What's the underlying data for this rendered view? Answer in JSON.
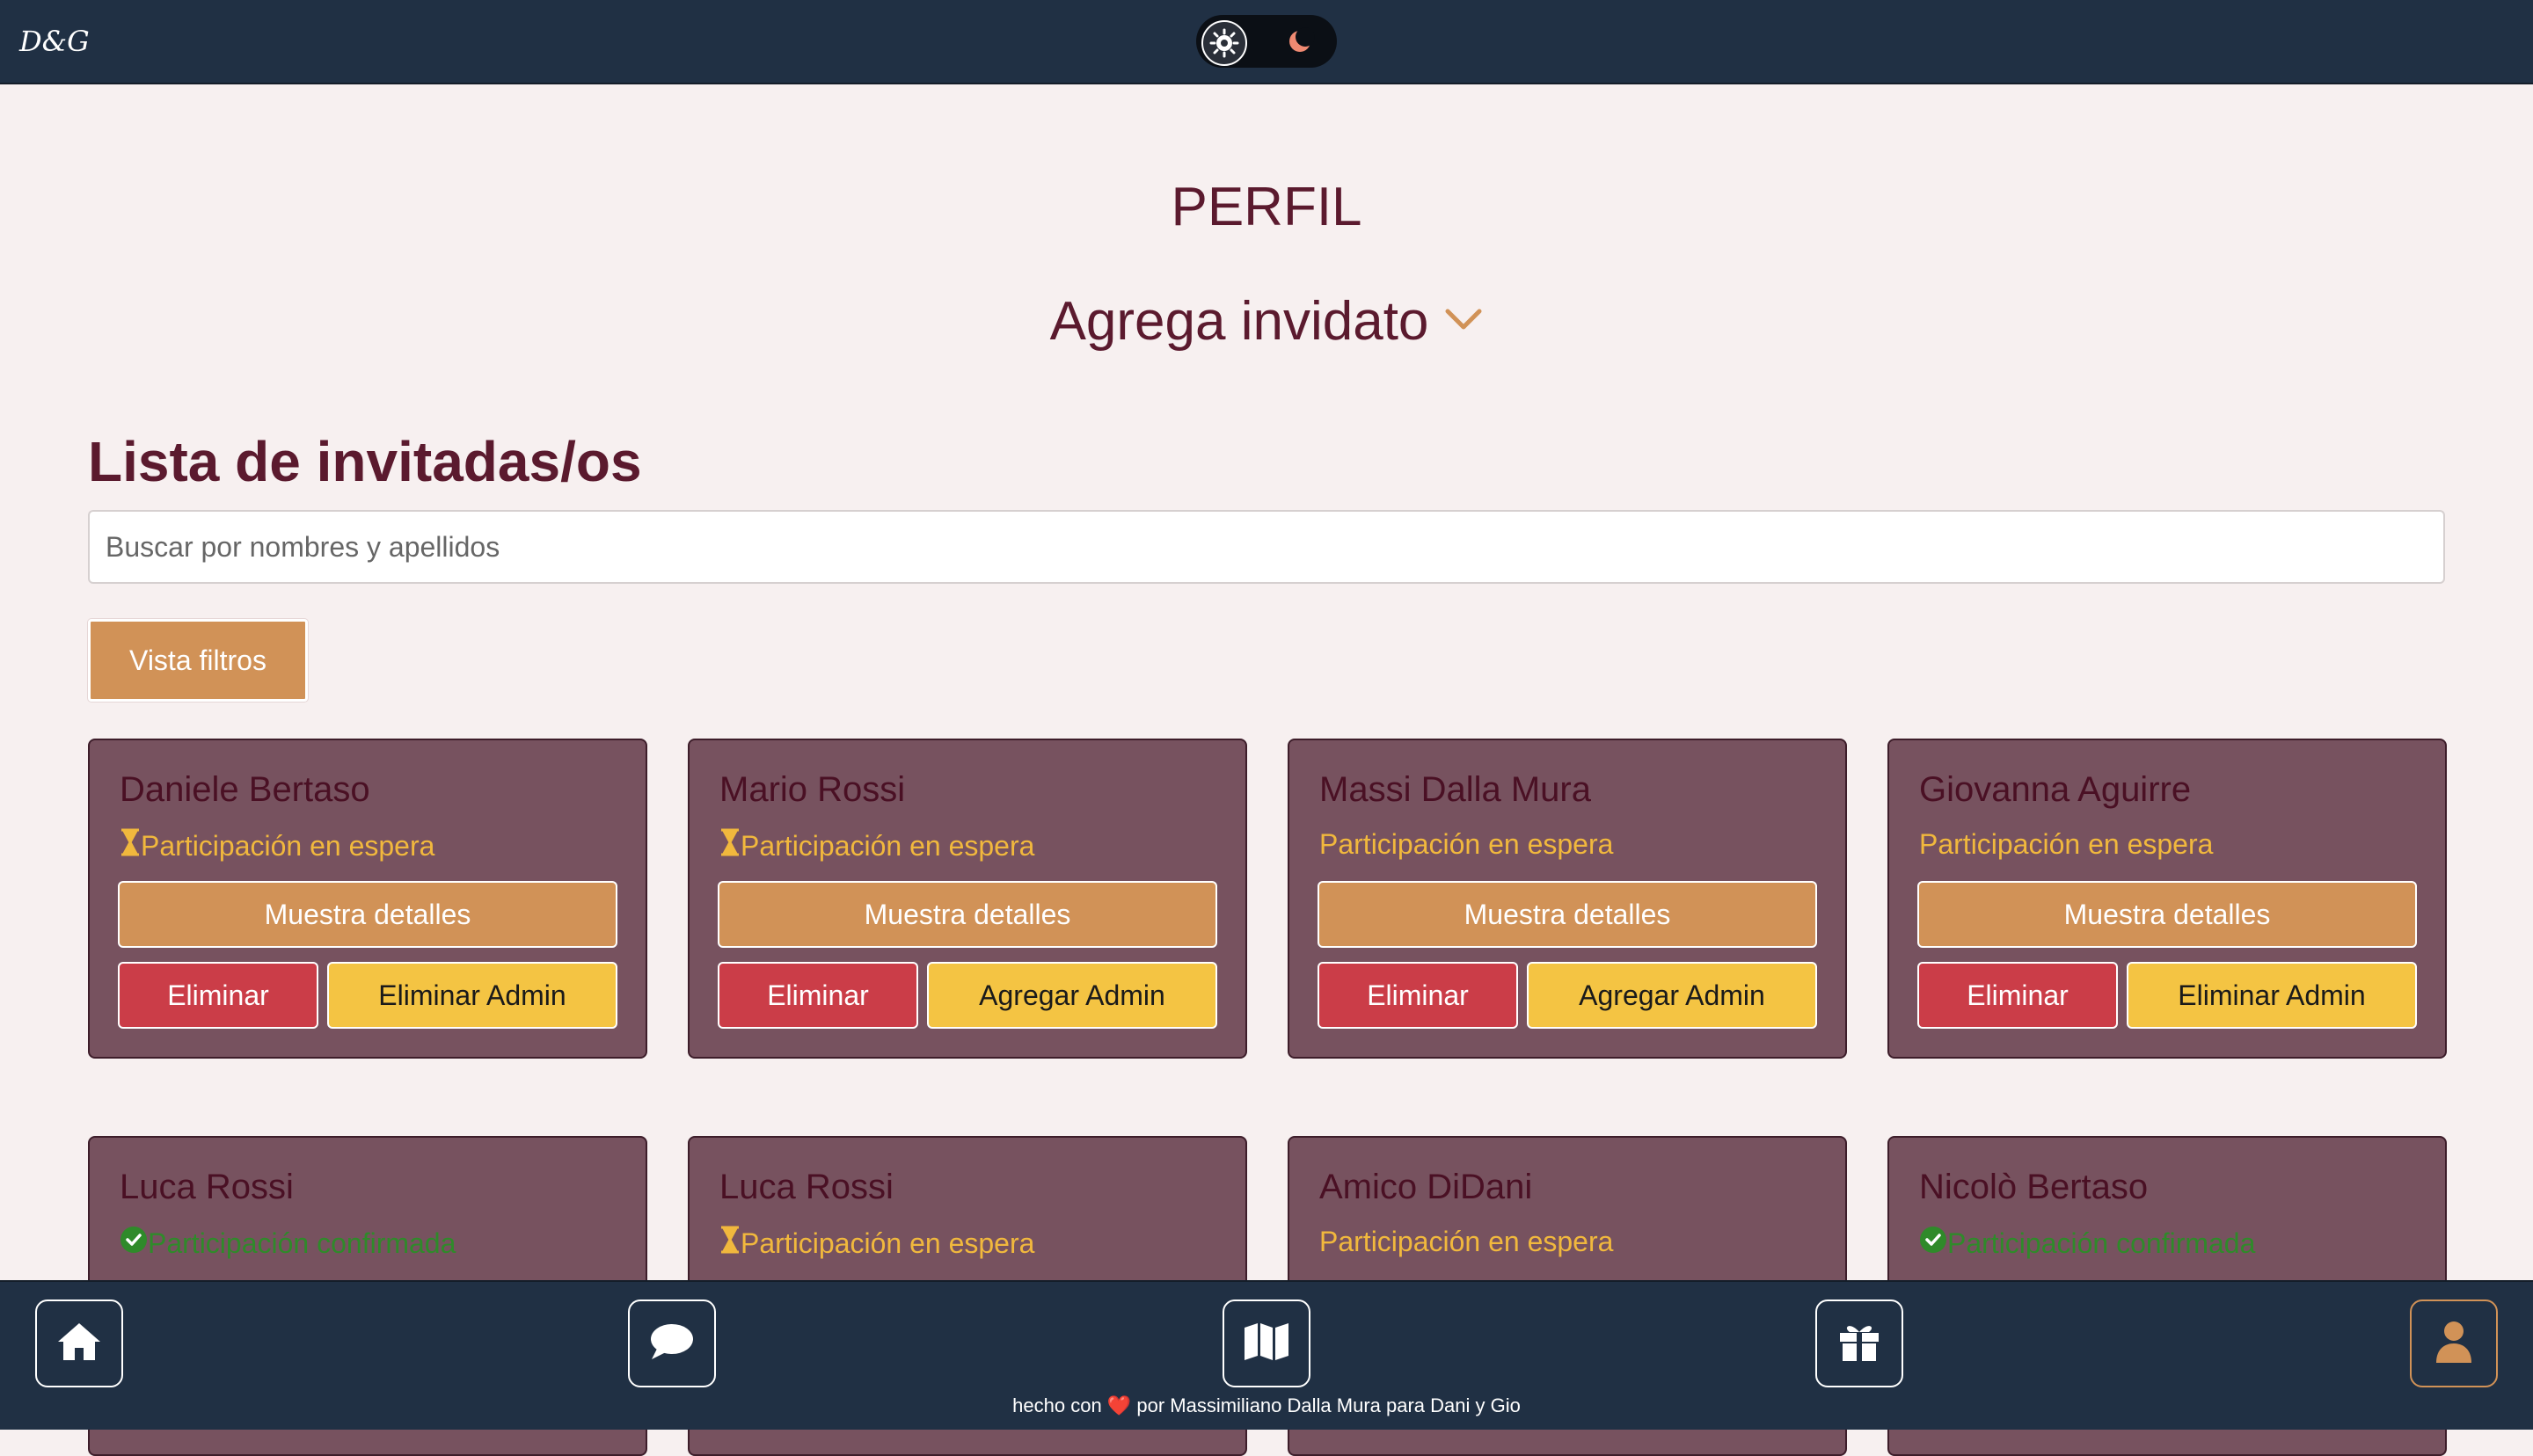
{
  "header": {
    "logo_text": "D&G",
    "theme_toggle": {
      "options": [
        "light",
        "dark"
      ],
      "selected": "light",
      "icons": [
        "sun-gear-icon",
        "moon-icon"
      ]
    }
  },
  "page": {
    "title": "PERFIL",
    "add_guest_label": "Agrega invidato",
    "list_title": "Lista de invitadas/os",
    "search_placeholder": "Buscar por nombres y apellidos",
    "filters_button": "Vista filtros"
  },
  "colors": {
    "accent": "#d19257",
    "card_bg": "#77525f",
    "danger": "#cb3d48",
    "warning": "#f4c443",
    "status_pending": "#f1b83d",
    "status_confirmed": "#2f8a2a",
    "nav_bg": "#203044"
  },
  "guests": [
    {
      "name": "Daniele Bertaso",
      "status": "Participación en espera",
      "status_icon": "hourglass-icon",
      "details_label": "Muestra detalles",
      "delete_label": "Eliminar",
      "admin_label": "Eliminar Admin"
    },
    {
      "name": "Mario Rossi",
      "status": "Participación en espera",
      "status_icon": "hourglass-icon",
      "details_label": "Muestra detalles",
      "delete_label": "Eliminar",
      "admin_label": "Agregar Admin"
    },
    {
      "name": "Massi Dalla Mura",
      "status": "Participación en espera",
      "status_icon": "",
      "details_label": "Muestra detalles",
      "delete_label": "Eliminar",
      "admin_label": "Agregar Admin"
    },
    {
      "name": "Giovanna Aguirre",
      "status": "Participación en espera",
      "status_icon": "",
      "details_label": "Muestra detalles",
      "delete_label": "Eliminar",
      "admin_label": "Eliminar Admin"
    },
    {
      "name": "Luca Rossi",
      "status": "Participación confirmada",
      "status_icon": "check-circle-icon"
    },
    {
      "name": "Luca Rossi",
      "status": "Participación en espera",
      "status_icon": "hourglass-icon"
    },
    {
      "name": "Amico DiDani",
      "status": "Participación en espera",
      "status_icon": ""
    },
    {
      "name": "Nicolò Bertaso",
      "status": "Participación confirmada",
      "status_icon": "check-circle-icon"
    }
  ],
  "bottom_nav": {
    "items": [
      {
        "icon": "home-icon",
        "active": false
      },
      {
        "icon": "chat-icon",
        "active": false
      },
      {
        "icon": "map-icon",
        "active": false
      },
      {
        "icon": "gift-icon",
        "active": false
      },
      {
        "icon": "user-icon",
        "active": true
      }
    ],
    "footer_prefix": "hecho con",
    "footer_heart": "❤️",
    "footer_suffix": "por Massimiliano Dalla Mura para Dani y Gio"
  }
}
